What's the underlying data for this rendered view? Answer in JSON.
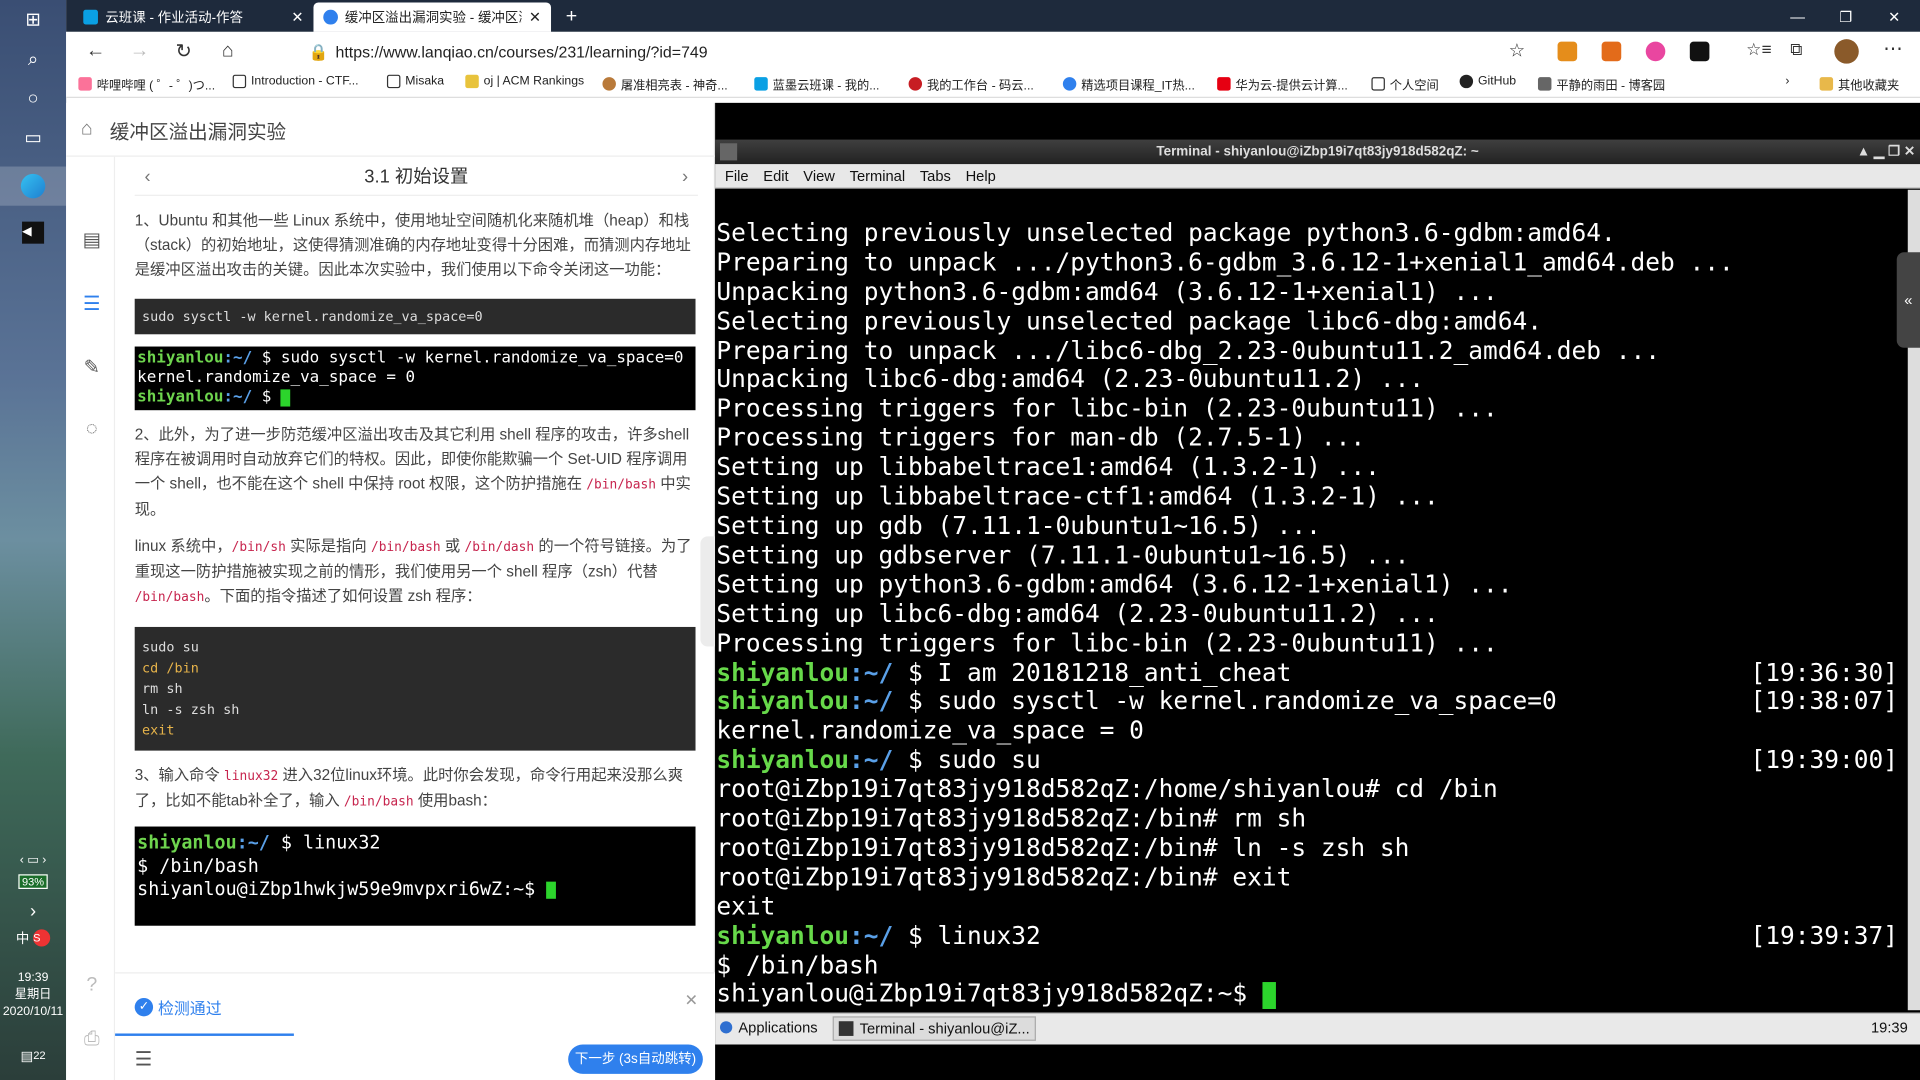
{
  "taskbar": {
    "battery": "93%",
    "ime": "中",
    "time": "19:39",
    "weekday": "星期日",
    "date": "2020/10/11",
    "notif_count": "22"
  },
  "browser": {
    "tabs": [
      {
        "label": "云班课 - 作业活动-作答"
      },
      {
        "label": "缓冲区溢出漏洞实验 - 缓冲区溢"
      }
    ],
    "url": "https://www.lanqiao.cn/courses/231/learning/?id=749",
    "bookmarks": [
      "哔哩哔哩 ( ゜- ゜)つ...",
      "Introduction - CTF...",
      "Misaka",
      "oj | ACM Rankings",
      "屠准相亮表 - 神奇...",
      "蓝墨云班课 - 我的...",
      "我的工作台 - 码云...",
      "精选项目课程_IT热...",
      "华为云-提供云计算...",
      "个人空间",
      "GitHub",
      "平静的雨田 - 博客园",
      "其他收藏夹"
    ]
  },
  "lesson": {
    "title": "缓冲区溢出漏洞实验",
    "section": "3.1 初始设置",
    "p1": "1、Ubuntu 和其他一些 Linux 系统中，使用地址空间随机化来随机堆（heap）和栈（stack）的初始地址，这使得猜测准确的内存地址变得十分困难，而猜测内存地址是缓冲区溢出攻击的关键。因此本次实验中，我们使用以下命令关闭这一功能：",
    "code1": "sudo sysctl -w kernel.randomize_va_space=0",
    "term1_prompt": "shiyanlou",
    "term1_path": ":~/",
    "term1_cmd": " $ sudo sysctl -w kernel.randomize_va_space=0",
    "term1_out": "kernel.randomize_va_space = 0",
    "term1_dollar": " $ ",
    "p2a": "2、此外，为了进一步防范缓冲区溢出攻击及其它利用 shell 程序的攻击，许多shell程序在被调用时自动放弃它们的特权。因此，即使你能欺骗一个 Set-UID 程序调用一个 shell，也不能在这个 shell 中保持 root 权限，这个防护措施在",
    "p2_code": "/bin/bash",
    "p2b": "中实现。",
    "p3a": "linux 系统中，",
    "p3_c1": "/bin/sh",
    "p3b": "实际是指向",
    "p3_c2": "/bin/bash",
    "p3c": "或",
    "p3_c3": "/bin/dash",
    "p3d": "的一个符号链接。为了重现这一防护措施被实现之前的情形，我们使用另一个 shell 程序（zsh）代替",
    "p3_c4": "/bin/bash",
    "p3e": "。下面的指令描述了如何设置 zsh 程序：",
    "code2": [
      "sudo su",
      "cd /bin",
      "rm sh",
      "ln -s zsh sh",
      "exit"
    ],
    "p4a": "3、输入命令",
    "p4_c1": "linux32",
    "p4b": "进入32位linux环境。此时你会发现，命令行用起来没那么爽了，比如不能tab补全了，输入",
    "p4_c2": "/bin/bash",
    "p4c": "使用bash：",
    "term2_cmd": " $ linux32",
    "term2_l2": "$ /bin/bash",
    "term2_l3": "shiyanlou@iZbp1hwkjw59e9mvpxri6wZ:~$ ",
    "pass_label": "检测通过",
    "next_label": "下一步 (3s自动跳转)"
  },
  "terminal": {
    "title": "Terminal - shiyanlou@iZbp19i7qt83jy918d582qZ: ~",
    "menu": [
      "File",
      "Edit",
      "View",
      "Terminal",
      "Tabs",
      "Help"
    ],
    "lines": [
      "Selecting previously unselected package python3.6-gdbm:amd64.",
      "Preparing to unpack .../python3.6-gdbm_3.6.12-1+xenial1_amd64.deb ...",
      "Unpacking python3.6-gdbm:amd64 (3.6.12-1+xenial1) ...",
      "Selecting previously unselected package libc6-dbg:amd64.",
      "Preparing to unpack .../libc6-dbg_2.23-0ubuntu11.2_amd64.deb ...",
      "Unpacking libc6-dbg:amd64 (2.23-0ubuntu11.2) ...",
      "Processing triggers for libc-bin (2.23-0ubuntu11) ...",
      "Processing triggers for man-db (2.7.5-1) ...",
      "Setting up libbabeltrace1:amd64 (1.3.2-1) ...",
      "Setting up libbabeltrace-ctf1:amd64 (1.3.2-1) ...",
      "Setting up gdb (7.11.1-0ubuntu1~16.5) ...",
      "Setting up gdbserver (7.11.1-0ubuntu1~16.5) ...",
      "Setting up python3.6-gdbm:amd64 (3.6.12-1+xenial1) ...",
      "Setting up libc6-dbg:amd64 (2.23-0ubuntu11.2) ...",
      "Processing triggers for libc-bin (2.23-0ubuntu11) ..."
    ],
    "prompt_user": "shiyanlou",
    "prompt_path": ":~/",
    "cmd1": " $ I am 20181218_anti_cheat",
    "ts1": "[19:36:30]",
    "cmd2": " $ sudo sysctl -w kernel.randomize_va_space=0",
    "ts2": "[19:38:07]",
    "out2": "kernel.randomize_va_space = 0",
    "cmd3": " $ sudo su",
    "ts3": "[19:39:00]",
    "root1": "root@iZbp19i7qt83jy918d582qZ:/home/shiyanlou# cd /bin",
    "root2": "root@iZbp19i7qt83jy918d582qZ:/bin# rm sh",
    "root3": "root@iZbp19i7qt83jy918d582qZ:/bin# ln -s zsh sh",
    "root4": "root@iZbp19i7qt83jy918d582qZ:/bin# exit",
    "exit": "exit",
    "cmd4": " $ linux32",
    "ts4": "[19:39:37]",
    "l_bash": "$ /bin/bash",
    "l_last": "shiyanlou@iZbp19i7qt83jy918d582qZ:~$ ",
    "panel_apps": "Applications",
    "panel_task": "Terminal - shiyanlou@iZ...",
    "panel_time": "19:39"
  }
}
